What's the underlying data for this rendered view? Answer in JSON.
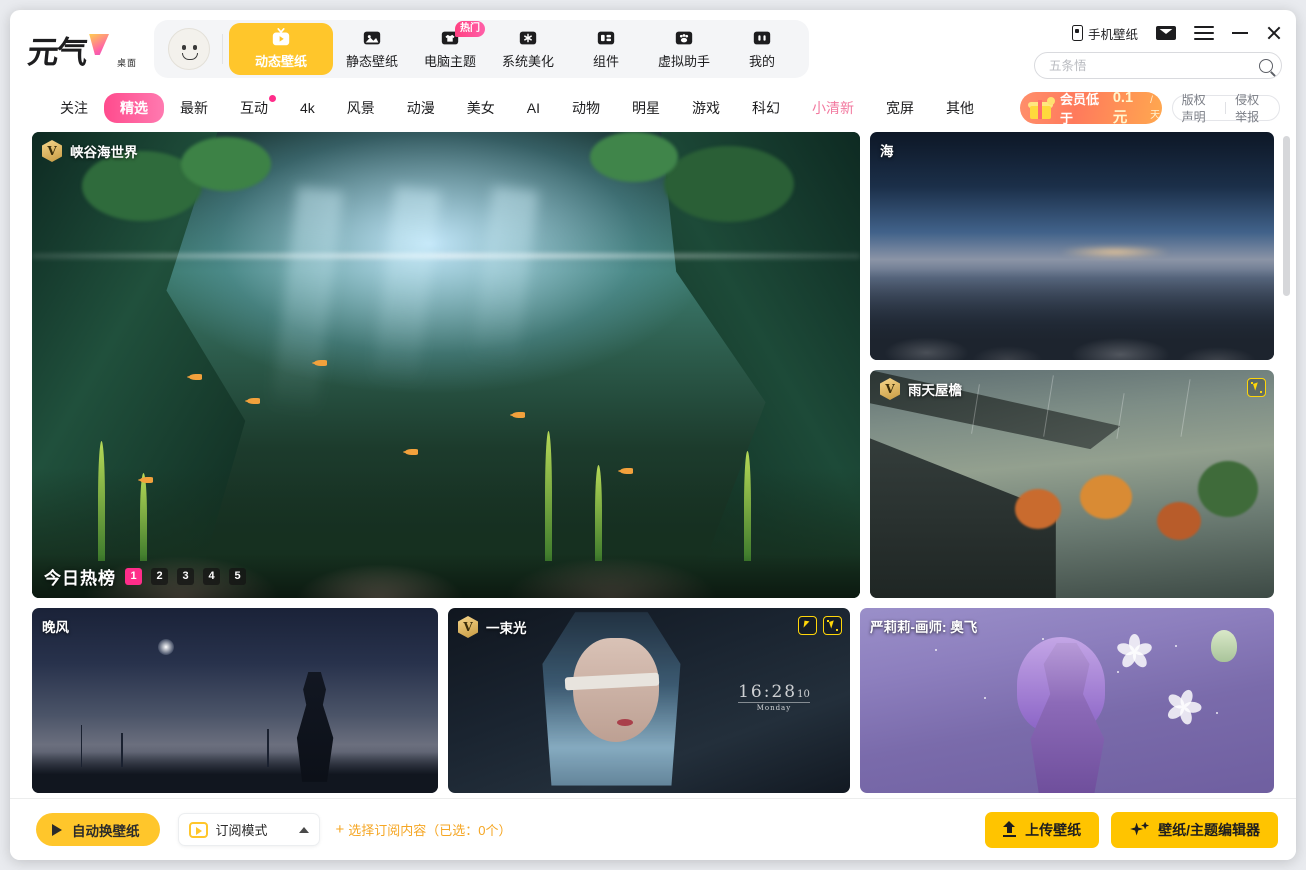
{
  "header": {
    "logo_text": "元气",
    "logo_sub": "桌面",
    "avatar_name": "user-avatar",
    "nav": [
      {
        "label": "动态壁纸",
        "icon": "tv-play-icon",
        "active": true,
        "badge": ""
      },
      {
        "label": "静态壁纸",
        "icon": "image-icon",
        "active": false,
        "badge": ""
      },
      {
        "label": "电脑主题",
        "icon": "shirt-icon",
        "active": false,
        "badge": "热门"
      },
      {
        "label": "系统美化",
        "icon": "snowflake-icon",
        "active": false,
        "badge": ""
      },
      {
        "label": "组件",
        "icon": "layout-icon",
        "active": false,
        "badge": ""
      },
      {
        "label": "虚拟助手",
        "icon": "paw-icon",
        "active": false,
        "badge": ""
      },
      {
        "label": "我的",
        "icon": "face-icon",
        "active": false,
        "badge": ""
      }
    ],
    "phone_wallpaper": "手机壁纸",
    "mail_icon": "mail-icon",
    "menu_icon": "hamburger-menu-icon",
    "minimize_icon": "minimize-icon",
    "close_icon": "close-icon",
    "search": {
      "value": "",
      "placeholder": "五条悟",
      "icon": "search-icon"
    }
  },
  "categories": [
    {
      "label": "关注",
      "active": false,
      "dot": false,
      "highlight": false
    },
    {
      "label": "精选",
      "active": true,
      "dot": false,
      "highlight": false
    },
    {
      "label": "最新",
      "active": false,
      "dot": false,
      "highlight": false
    },
    {
      "label": "互动",
      "active": false,
      "dot": true,
      "highlight": false
    },
    {
      "label": "4k",
      "active": false,
      "dot": false,
      "highlight": false
    },
    {
      "label": "风景",
      "active": false,
      "dot": false,
      "highlight": false
    },
    {
      "label": "动漫",
      "active": false,
      "dot": false,
      "highlight": false
    },
    {
      "label": "美女",
      "active": false,
      "dot": false,
      "highlight": false
    },
    {
      "label": "AI",
      "active": false,
      "dot": false,
      "highlight": false
    },
    {
      "label": "动物",
      "active": false,
      "dot": false,
      "highlight": false
    },
    {
      "label": "明星",
      "active": false,
      "dot": false,
      "highlight": false
    },
    {
      "label": "游戏",
      "active": false,
      "dot": false,
      "highlight": false
    },
    {
      "label": "科幻",
      "active": false,
      "dot": false,
      "highlight": false
    },
    {
      "label": "小清新",
      "active": false,
      "dot": false,
      "highlight": true
    },
    {
      "label": "宽屏",
      "active": false,
      "dot": false,
      "highlight": false
    },
    {
      "label": "其他",
      "active": false,
      "dot": false,
      "highlight": false
    }
  ],
  "vip_banner": {
    "prefix": "会员低于",
    "price": "0.1元",
    "suffix": "/天",
    "icon": "gift-icon"
  },
  "copyright_links": [
    {
      "label": "版权声明"
    },
    {
      "label": "侵权举报"
    }
  ],
  "cards": {
    "hero": {
      "title": "峡谷海世界",
      "vip": true,
      "hot_list_label": "今日热榜",
      "pages": [
        "1",
        "2",
        "3",
        "4",
        "5"
      ],
      "active_page": "1"
    },
    "sea": {
      "title": "海",
      "vip": false,
      "icons": []
    },
    "rain": {
      "title": "雨天屋檐",
      "vip": true,
      "icons": [
        "sparkle-cursor-icon"
      ]
    },
    "night": {
      "title": "晚风",
      "vip": false,
      "icons": []
    },
    "beam": {
      "title": "一束光",
      "vip": true,
      "icons": [
        "cursor-icon",
        "sparkle-cursor-icon"
      ],
      "clock_time": "16:28",
      "clock_seconds": "10",
      "clock_day": "Monday"
    },
    "anime": {
      "title": "严莉莉-画师: 奥飞",
      "vip": false,
      "icons": []
    }
  },
  "footer": {
    "auto_change": "自动换壁纸",
    "play_icon": "play-icon",
    "subscribe_mode": "订阅模式",
    "subscribe_icon": "tv-icon",
    "caret_icon": "caret-up-icon",
    "select_content": "选择订阅内容（已选：0个）",
    "plus": "+",
    "upload": "上传壁纸",
    "upload_icon": "upload-icon",
    "editor": "壁纸/主题编辑器",
    "editor_icon": "magic-wand-icon"
  },
  "colors": {
    "accent_yellow": "#ffc62b",
    "accent_pink": "#ff4b8d",
    "vip_gold": "#e0b44c",
    "link_orange": "#f5a623"
  }
}
